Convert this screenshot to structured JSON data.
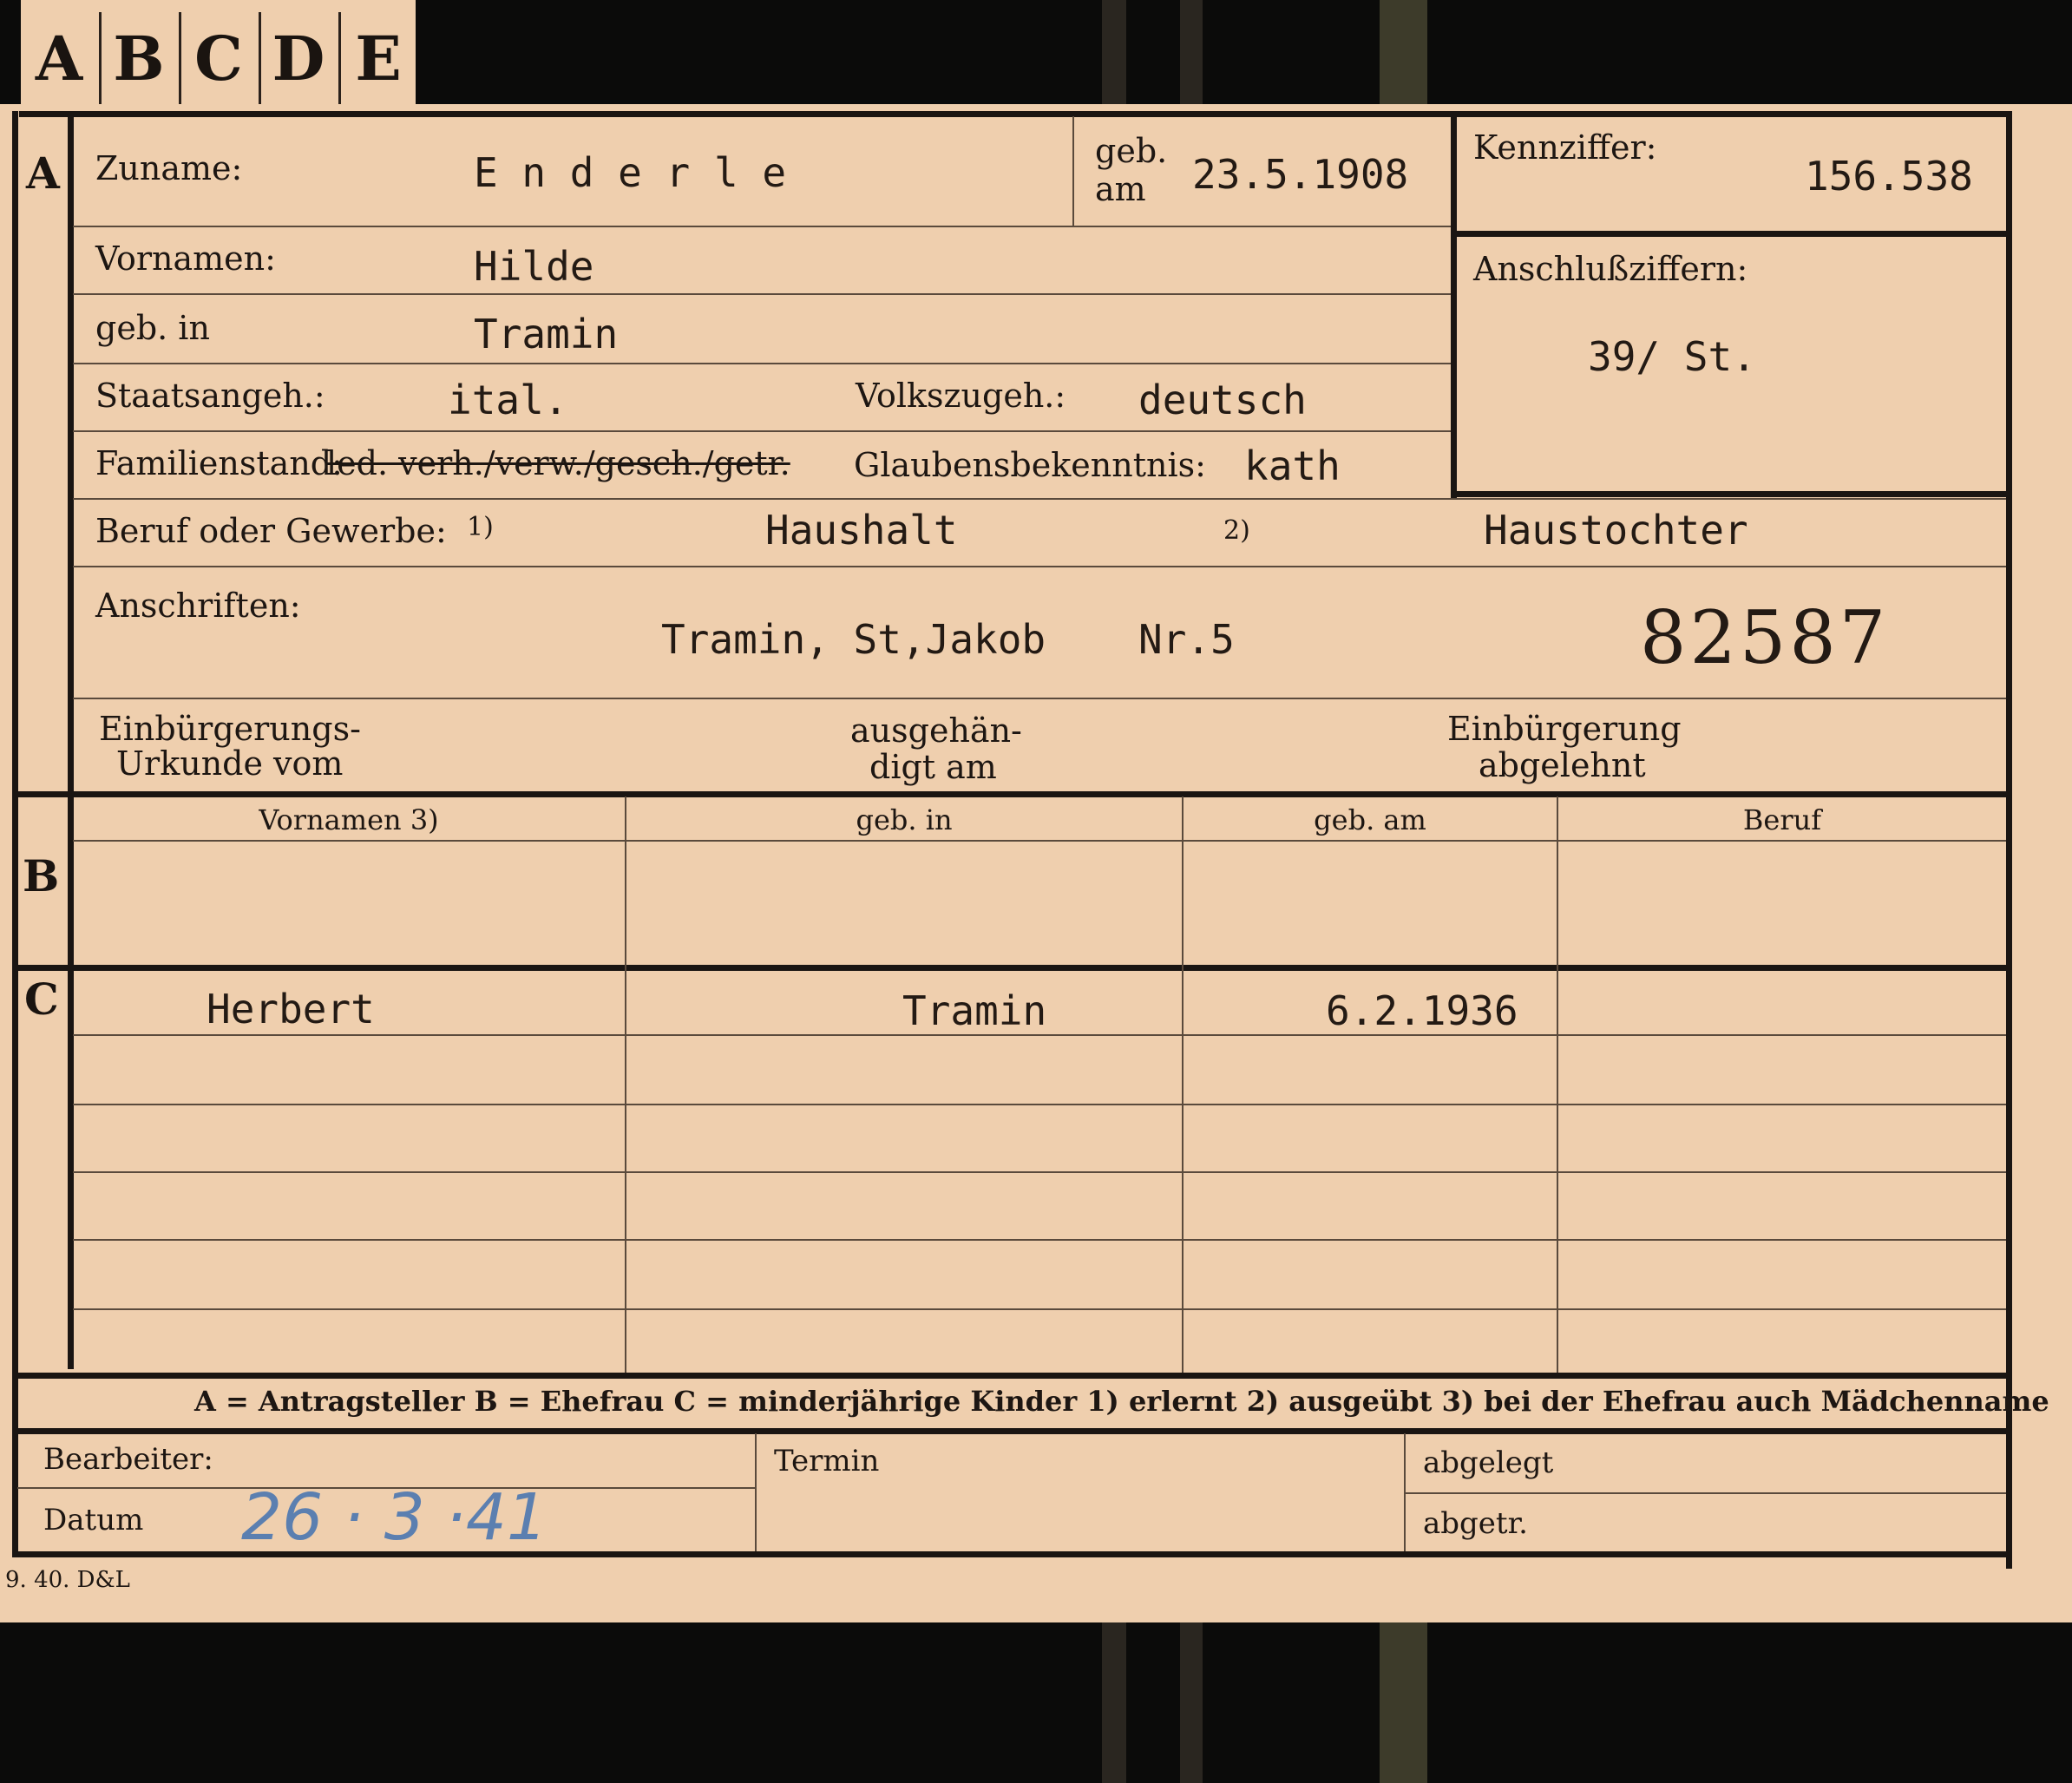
{
  "tabs": [
    "A",
    "B",
    "C",
    "D",
    "E"
  ],
  "section_A": {
    "marker": "A",
    "surname_label": "Zuname:",
    "surname_value": "E n d e r l e",
    "birthdate_label_top": "geb.",
    "birthdate_label_bottom": "am",
    "birthdate_value": "23.5.1908",
    "id_label": "Kennziffer:",
    "id_value": "156.538",
    "firstname_label": "Vornamen:",
    "firstname_value": "Hilde",
    "birthplace_label": "geb. in",
    "birthplace_value": "Tramin",
    "link_label": "Anschlußziffern:",
    "link_value": "39/  St.",
    "citizenship_label": "Staatsangeh.:",
    "citizenship_value": "ital.",
    "ethnicity_label": "Volkszugeh.:",
    "ethnicity_value": "deutsch",
    "marital_label": "Familienstand:",
    "marital_options": "led. verh./verw./gesch./getr.",
    "religion_label": "Glaubensbekenntnis:",
    "religion_value": "kath",
    "occupation_label": "Beruf oder Gewerbe:",
    "occupation_note1": "1)",
    "occupation_value1": "Haushalt",
    "occupation_note2": "2)",
    "occupation_value2": "Haustochter",
    "address_label": "Anschriften:",
    "address_value": "Tramin, St,Jakob",
    "address_number": "Nr.5",
    "stamp_number": "82587",
    "naturalization_certificate_line1": "Einbürgerungs-",
    "naturalization_certificate_line2": "Urkunde vom",
    "handed_out_line1": "ausgehän-",
    "handed_out_line2": "digt am",
    "naturalization_refused_line1": "Einbürgerung",
    "naturalization_refused_line2": "abgelehnt"
  },
  "section_B": {
    "marker": "B",
    "columns": [
      "Vornamen 3)",
      "geb. in",
      "geb. am",
      "Beruf"
    ]
  },
  "section_C": {
    "marker": "C",
    "rows": [
      {
        "name": "Herbert",
        "place": "Tramin",
        "date": "6.2.1936",
        "job": ""
      }
    ]
  },
  "legend": "A = Antragsteller   B = Ehefrau   C = minderjährige Kinder   1) erlernt   2) ausgeübt   3) bei der Ehefrau auch Mädchenname",
  "footer": {
    "editor_label": "Bearbeiter:",
    "date_label": "Datum",
    "date_value": "26 · 3 ·41",
    "deadline_label": "Termin",
    "filed_label": "abgelegt",
    "removed_label": "abgetr.",
    "print_code": "9. 40. D&L"
  }
}
